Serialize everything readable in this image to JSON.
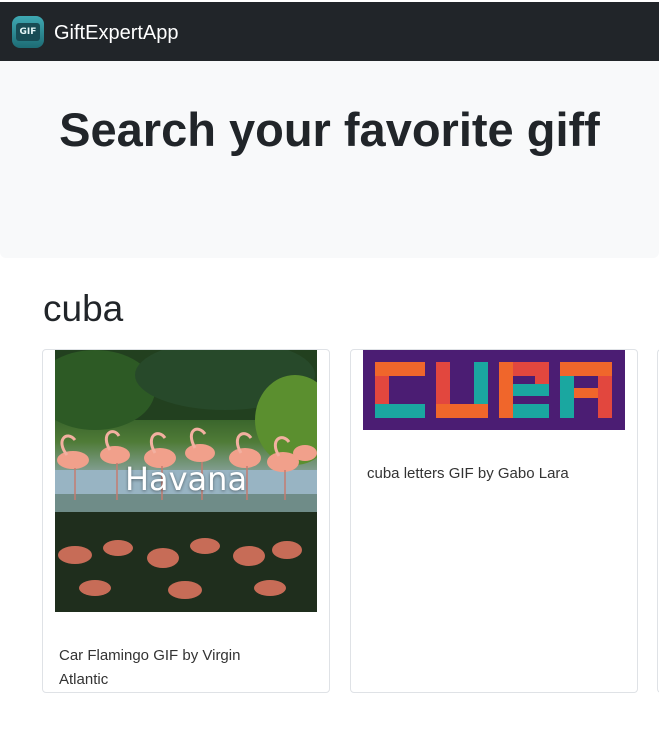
{
  "navbar": {
    "logo_text": "GIF",
    "brand": "GiftExpertApp"
  },
  "hero": {
    "title": "Search your favorite giff"
  },
  "category": {
    "title": "cuba"
  },
  "gifs": [
    {
      "title": "Car Flamingo GIF by Virgin Atlantic",
      "overlay_text": "Havana"
    },
    {
      "title": "cuba letters GIF by Gabo Lara"
    }
  ],
  "colors": {
    "navbar_bg": "#212529",
    "jumbotron_bg": "#f8f9fa",
    "cuba_bg": "#4b1d73",
    "cuba_orange": "#f0662b",
    "cuba_teal": "#1aa7a0",
    "cuba_red": "#e2473e"
  }
}
